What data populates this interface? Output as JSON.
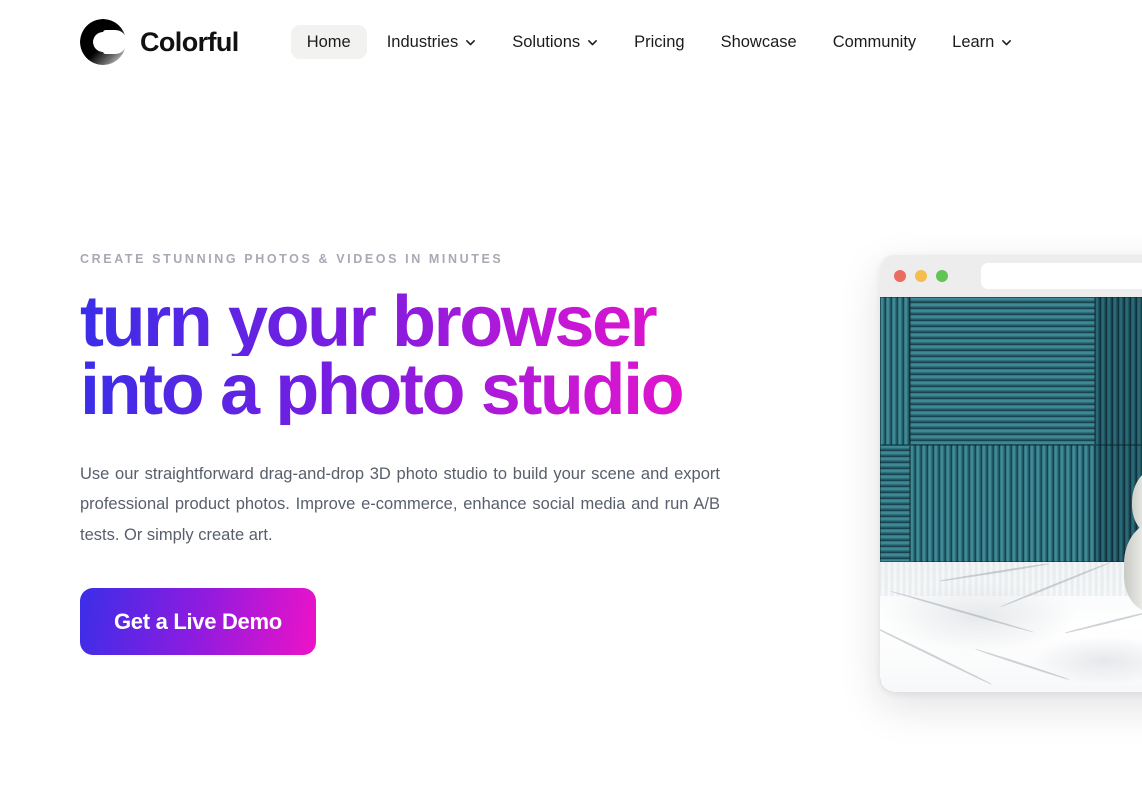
{
  "brand": {
    "name": "Colorful",
    "logo_icon": "colorful-c-logo-icon"
  },
  "nav": {
    "items": [
      {
        "label": "Home",
        "active": true,
        "has_dropdown": false
      },
      {
        "label": "Industries",
        "active": false,
        "has_dropdown": true
      },
      {
        "label": "Solutions",
        "active": false,
        "has_dropdown": true
      },
      {
        "label": "Pricing",
        "active": false,
        "has_dropdown": false
      },
      {
        "label": "Showcase",
        "active": false,
        "has_dropdown": false
      },
      {
        "label": "Community",
        "active": false,
        "has_dropdown": false
      },
      {
        "label": "Learn",
        "active": false,
        "has_dropdown": true
      }
    ]
  },
  "hero": {
    "eyebrow": "CREATE STUNNING PHOTOS & VIDEOS IN MINUTES",
    "headline_line1": "turn your browser",
    "headline_line2": "into a photo studio",
    "lede": "Use our straightforward drag-and-drop 3D photo studio to build your scene and export professional product photos. Improve e-commerce, enhance social media and run A/B tests. Or simply create art.",
    "cta_label": "Get a Live Demo"
  },
  "mockup": {
    "traffic_lights": [
      "close-dot-red",
      "minimize-dot-yellow",
      "maximize-dot-green"
    ],
    "url_value": "",
    "url_placeholder": "",
    "scene_description": "teal fluted tile wall with white ceramic vase on white marble surface"
  },
  "colors": {
    "gradient_start": "#3b2ee8",
    "gradient_mid": "#8a1ce0",
    "gradient_end": "#ee12c8",
    "eyebrow": "#a9a9b4",
    "body_text": "#585f6b",
    "nav_text": "#1c1c1c",
    "nav_active_bg": "#f2f2f0",
    "page_bg": "#ffffff",
    "traffic_red": "#ec6a5e",
    "traffic_yellow": "#f5bd4f",
    "traffic_green": "#61c454"
  }
}
